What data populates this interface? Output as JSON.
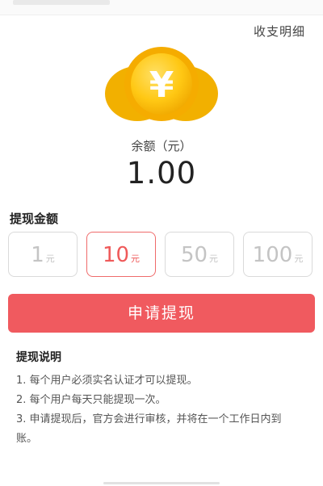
{
  "header": {
    "detail_link": "收支明细"
  },
  "coin": {
    "symbol": "¥",
    "icon": "yuan-coin-icon",
    "colors": {
      "outer": "#f5b400",
      "inner": "#ffc814",
      "symbol": "#ffffff"
    }
  },
  "balance": {
    "label": "余额（元）",
    "value": "1.00"
  },
  "withdraw": {
    "section_title": "提现金额",
    "amounts": [
      {
        "value": "1",
        "unit": "元",
        "selected": false
      },
      {
        "value": "10",
        "unit": "元",
        "selected": true
      },
      {
        "value": "50",
        "unit": "元",
        "selected": false
      },
      {
        "value": "100",
        "unit": "元",
        "selected": false
      }
    ],
    "submit_label": "申请提现",
    "accent_color": "#f05a5f"
  },
  "notes": {
    "title": "提现说明",
    "items": [
      "1. 每个用户必须实名认证才可以提现。",
      "2. 每个用户每天只能提现一次。",
      "3. 申请提现后，官方会进行审核，并将在一个工作日内到账。"
    ]
  }
}
